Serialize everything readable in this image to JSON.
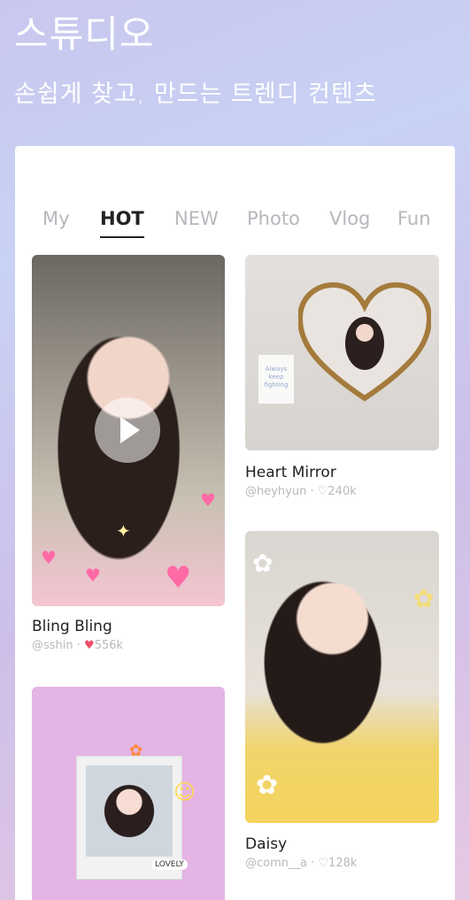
{
  "header": {
    "title": "스튜디오",
    "subtitle": "손쉽게 찾고, 만드는 트렌디 컨텐츠"
  },
  "tabs": [
    {
      "label": "My",
      "active": false
    },
    {
      "label": "HOT",
      "active": true
    },
    {
      "label": "NEW",
      "active": false
    },
    {
      "label": "Photo",
      "active": false
    },
    {
      "label": "Vlog",
      "active": false
    },
    {
      "label": "Fun",
      "active": false
    }
  ],
  "items": [
    {
      "title": "Bling Bling",
      "author": "@sshin",
      "likes": "556k",
      "liked": true,
      "type": "video"
    },
    {
      "title": "Heart Mirror",
      "author": "@heyhyun",
      "likes": "240k",
      "liked": false,
      "type": "photo"
    },
    {
      "title": "Daisy",
      "author": "@comn__a",
      "likes": "128k",
      "liked": false,
      "type": "photo"
    },
    {
      "title": "",
      "author": "",
      "likes": "",
      "liked": false,
      "type": "photo",
      "sticker_text": "LOVELY"
    }
  ],
  "heart_note": "Always keep fighting",
  "separator": " · ",
  "colors": {
    "accent_heart": "#ef4f6b",
    "tab_inactive": "#b7b7bd",
    "tab_active": "#222222"
  }
}
